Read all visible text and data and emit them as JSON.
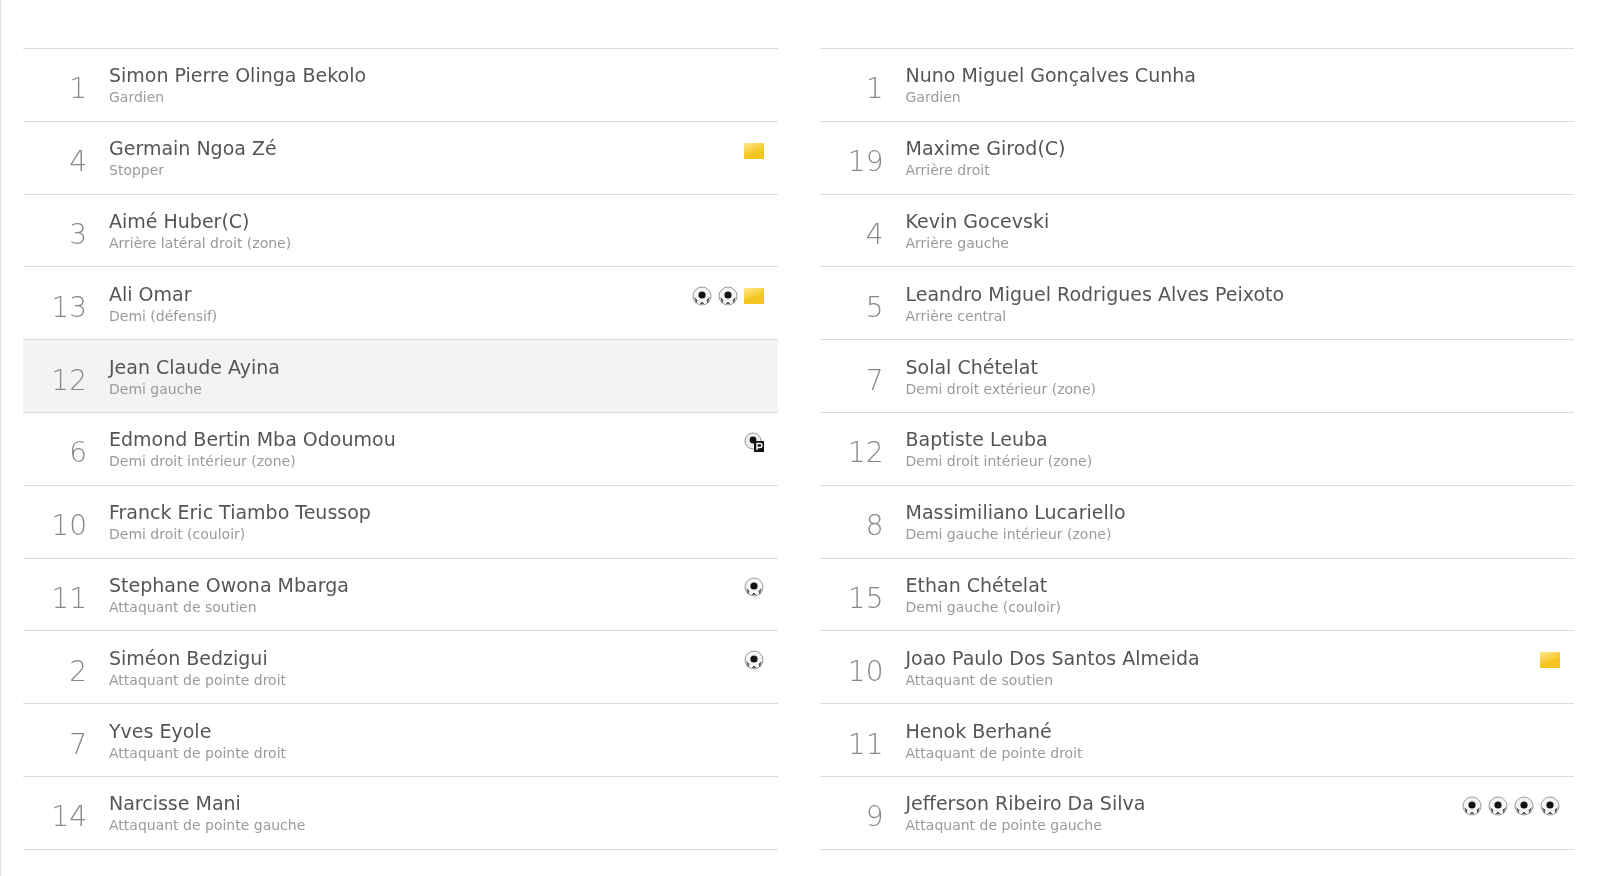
{
  "teams": [
    {
      "players": [
        {
          "number": "1",
          "name": "Simon Pierre Olinga Bekolo",
          "position": "Gardien",
          "selected": false
        },
        {
          "number": "4",
          "name": "Germain Ngoa Zé",
          "position": "Stopper",
          "selected": false,
          "events": [
            {
              "kind": "yellow-card"
            }
          ]
        },
        {
          "number": "3",
          "name": "Aimé Huber(C)",
          "position": "Arrière latéral droit (zone)",
          "selected": false
        },
        {
          "number": "13",
          "name": "Ali Omar",
          "position": "Demi (défensif)",
          "selected": false,
          "events": [
            {
              "kind": "goal"
            },
            {
              "kind": "goal"
            },
            {
              "kind": "yellow-card"
            }
          ]
        },
        {
          "number": "12",
          "name": "Jean Claude Ayina",
          "position": "Demi gauche",
          "selected": true
        },
        {
          "number": "6",
          "name": "Edmond Bertin Mba Odoumou",
          "position": "Demi droit intérieur (zone)",
          "selected": false,
          "events": [
            {
              "kind": "penalty-goal"
            }
          ]
        },
        {
          "number": "10",
          "name": "Franck Eric Tiambo Teussop",
          "position": "Demi droit (couloir)",
          "selected": false
        },
        {
          "number": "11",
          "name": "Stephane Owona Mbarga",
          "position": "Attaquant de soutien",
          "selected": false,
          "events": [
            {
              "kind": "goal"
            }
          ]
        },
        {
          "number": "2",
          "name": "Siméon Bedzigui",
          "position": "Attaquant de pointe droit",
          "selected": false,
          "events": [
            {
              "kind": "goal"
            }
          ]
        },
        {
          "number": "7",
          "name": "Yves Eyole",
          "position": "Attaquant de pointe droit",
          "selected": false
        },
        {
          "number": "14",
          "name": "Narcisse Mani",
          "position": "Attaquant de pointe gauche",
          "selected": false
        }
      ]
    },
    {
      "players": [
        {
          "number": "1",
          "name": "Nuno Miguel Gonçalves Cunha",
          "position": "Gardien",
          "selected": false
        },
        {
          "number": "19",
          "name": "Maxime Girod(C)",
          "position": "Arrière droit",
          "selected": false
        },
        {
          "number": "4",
          "name": "Kevin Gocevski",
          "position": "Arrière gauche",
          "selected": false
        },
        {
          "number": "5",
          "name": "Leandro Miguel Rodrigues Alves Peixoto",
          "position": "Arrière central",
          "selected": false
        },
        {
          "number": "7",
          "name": "Solal Chételat",
          "position": "Demi droit extérieur (zone)",
          "selected": false
        },
        {
          "number": "12",
          "name": "Baptiste Leuba",
          "position": "Demi droit intérieur (zone)",
          "selected": false
        },
        {
          "number": "8",
          "name": "Massimiliano Lucariello",
          "position": "Demi gauche intérieur (zone)",
          "selected": false
        },
        {
          "number": "15",
          "name": "Ethan Chételat",
          "position": "Demi gauche (couloir)",
          "selected": false
        },
        {
          "number": "10",
          "name": "Joao Paulo Dos Santos Almeida",
          "position": "Attaquant de soutien",
          "selected": false,
          "events": [
            {
              "kind": "yellow-card"
            }
          ]
        },
        {
          "number": "11",
          "name": "Henok Berhané",
          "position": "Attaquant de pointe droit",
          "selected": false
        },
        {
          "number": "9",
          "name": "Jefferson Ribeiro Da Silva",
          "position": "Attaquant de pointe gauche",
          "selected": false,
          "events": [
            {
              "kind": "goal"
            },
            {
              "kind": "goal"
            },
            {
              "kind": "goal"
            },
            {
              "kind": "goal"
            }
          ]
        }
      ]
    }
  ]
}
